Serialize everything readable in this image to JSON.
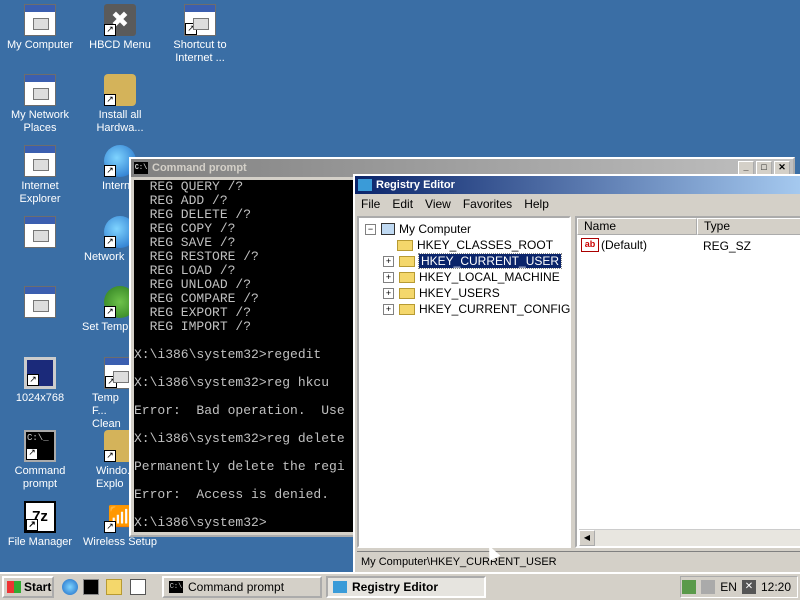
{
  "desktop": {
    "icons": [
      {
        "id": "my-computer",
        "label": "My Computer"
      },
      {
        "id": "hbcd-menu",
        "label": "HBCD Menu"
      },
      {
        "id": "shortcut-internet",
        "label": "Shortcut to Internet ..."
      },
      {
        "id": "my-network-places",
        "label": "My Network Places"
      },
      {
        "id": "install-all-hardware",
        "label": "Install all Hardwa..."
      },
      {
        "id": "internet-explorer",
        "label": "Internet Explorer"
      },
      {
        "id": "internet-partial",
        "label": "Intern"
      },
      {
        "id": "network-partial",
        "label": "Network"
      },
      {
        "id": "set-temp-partial",
        "label": "Set Temp"
      },
      {
        "id": "res-1024",
        "label": "1024x768"
      },
      {
        "id": "temp-clean-partial",
        "label": "Temp F... Clean"
      },
      {
        "id": "command-prompt",
        "label": "Command prompt"
      },
      {
        "id": "windows-explorer-partial",
        "label": "Windo... Explo"
      },
      {
        "id": "file-manager",
        "label": "File Manager"
      },
      {
        "id": "wireless-setup",
        "label": "Wireless Setup"
      }
    ]
  },
  "cmd_window": {
    "title": "Command prompt",
    "icon_text": "C:\\",
    "lines": [
      "  REG QUERY /?",
      "  REG ADD /?",
      "  REG DELETE /?",
      "  REG COPY /?",
      "  REG SAVE /?",
      "  REG RESTORE /?",
      "  REG LOAD /?",
      "  REG UNLOAD /?",
      "  REG COMPARE /?",
      "  REG EXPORT /?",
      "  REG IMPORT /?",
      "",
      "X:\\i386\\system32>regedit",
      "",
      "X:\\i386\\system32>reg hkcu",
      "",
      "Error:  Bad operation.  Use",
      "",
      "X:\\i386\\system32>reg delete",
      "",
      "Permanently delete the regi",
      "",
      "Error:  Access is denied.",
      "",
      "X:\\i386\\system32>"
    ]
  },
  "regedit": {
    "title": "Registry Editor",
    "menu": [
      "File",
      "Edit",
      "View",
      "Favorites",
      "Help"
    ],
    "tree": {
      "root": "My Computer",
      "keys": [
        {
          "label": "HKEY_CLASSES_ROOT",
          "expander": ""
        },
        {
          "label": "HKEY_CURRENT_USER",
          "expander": "+",
          "selected": true
        },
        {
          "label": "HKEY_LOCAL_MACHINE",
          "expander": "+"
        },
        {
          "label": "HKEY_USERS",
          "expander": "+"
        },
        {
          "label": "HKEY_CURRENT_CONFIG",
          "expander": "+"
        }
      ]
    },
    "columns": [
      "Name",
      "Type"
    ],
    "values": [
      {
        "name": "(Default)",
        "type": "REG_SZ",
        "icon_text": "ab"
      }
    ],
    "status": "My Computer\\HKEY_CURRENT_USER"
  },
  "taskbar": {
    "start_label": "Start",
    "tasks": [
      {
        "label": "Command prompt",
        "active": false
      },
      {
        "label": "Registry Editor",
        "active": true
      }
    ],
    "tray": {
      "lang": "EN",
      "time": "12:20"
    }
  },
  "colors": {
    "desktop": "#3a6ea5",
    "title_active": "#0a246a",
    "title_inactive": "#808080"
  }
}
